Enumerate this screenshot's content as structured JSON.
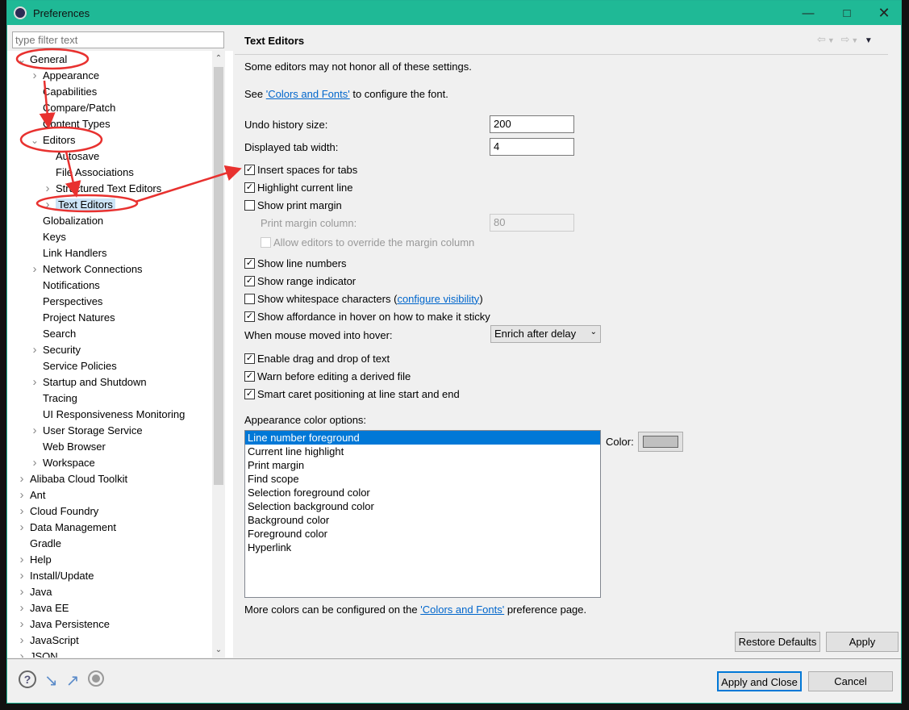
{
  "window": {
    "title": "Preferences",
    "controls": [
      "minimize",
      "maximize",
      "close"
    ]
  },
  "filter": {
    "placeholder": "type filter text",
    "value": ""
  },
  "tree": [
    {
      "label": "General",
      "level": 0,
      "arrow": "expanded"
    },
    {
      "label": "Appearance",
      "level": 1,
      "arrow": "collapsed"
    },
    {
      "label": "Capabilities",
      "level": 1,
      "arrow": ""
    },
    {
      "label": "Compare/Patch",
      "level": 1,
      "arrow": ""
    },
    {
      "label": "Content Types",
      "level": 1,
      "arrow": ""
    },
    {
      "label": "Editors",
      "level": 1,
      "arrow": "expanded"
    },
    {
      "label": "Autosave",
      "level": 2,
      "arrow": ""
    },
    {
      "label": "File Associations",
      "level": 2,
      "arrow": ""
    },
    {
      "label": "Structured Text Editors",
      "level": 2,
      "arrow": "collapsed"
    },
    {
      "label": "Text Editors",
      "level": 2,
      "arrow": "collapsed",
      "selected": true
    },
    {
      "label": "Globalization",
      "level": 1,
      "arrow": ""
    },
    {
      "label": "Keys",
      "level": 1,
      "arrow": ""
    },
    {
      "label": "Link Handlers",
      "level": 1,
      "arrow": ""
    },
    {
      "label": "Network Connections",
      "level": 1,
      "arrow": "collapsed"
    },
    {
      "label": "Notifications",
      "level": 1,
      "arrow": ""
    },
    {
      "label": "Perspectives",
      "level": 1,
      "arrow": ""
    },
    {
      "label": "Project Natures",
      "level": 1,
      "arrow": ""
    },
    {
      "label": "Search",
      "level": 1,
      "arrow": ""
    },
    {
      "label": "Security",
      "level": 1,
      "arrow": "collapsed"
    },
    {
      "label": "Service Policies",
      "level": 1,
      "arrow": ""
    },
    {
      "label": "Startup and Shutdown",
      "level": 1,
      "arrow": "collapsed"
    },
    {
      "label": "Tracing",
      "level": 1,
      "arrow": ""
    },
    {
      "label": "UI Responsiveness Monitoring",
      "level": 1,
      "arrow": ""
    },
    {
      "label": "User Storage Service",
      "level": 1,
      "arrow": "collapsed"
    },
    {
      "label": "Web Browser",
      "level": 1,
      "arrow": ""
    },
    {
      "label": "Workspace",
      "level": 1,
      "arrow": "collapsed"
    },
    {
      "label": "Alibaba Cloud Toolkit",
      "level": 0,
      "arrow": "collapsed"
    },
    {
      "label": "Ant",
      "level": 0,
      "arrow": "collapsed"
    },
    {
      "label": "Cloud Foundry",
      "level": 0,
      "arrow": "collapsed"
    },
    {
      "label": "Data Management",
      "level": 0,
      "arrow": "collapsed"
    },
    {
      "label": "Gradle",
      "level": 0,
      "arrow": ""
    },
    {
      "label": "Help",
      "level": 0,
      "arrow": "collapsed"
    },
    {
      "label": "Install/Update",
      "level": 0,
      "arrow": "collapsed"
    },
    {
      "label": "Java",
      "level": 0,
      "arrow": "collapsed"
    },
    {
      "label": "Java EE",
      "level": 0,
      "arrow": "collapsed"
    },
    {
      "label": "Java Persistence",
      "level": 0,
      "arrow": "collapsed"
    },
    {
      "label": "JavaScript",
      "level": 0,
      "arrow": "collapsed"
    },
    {
      "label": "JSON",
      "level": 0,
      "arrow": "collapsed"
    }
  ],
  "page": {
    "title": "Text Editors",
    "note": "Some editors may not honor all of these settings.",
    "see_prefix": "See ",
    "see_link": "'Colors and Fonts'",
    "see_suffix": " to configure the font.",
    "undo_label": "Undo history size:",
    "undo_value": "200",
    "tab_label": "Displayed tab width:",
    "tab_value": "4",
    "checks1": [
      {
        "label": "Insert spaces for tabs",
        "checked": true
      },
      {
        "label": "Highlight current line",
        "checked": true
      },
      {
        "label": "Show print margin",
        "checked": false
      }
    ],
    "margin_label": "Print margin column:",
    "margin_value": "80",
    "allow_override": {
      "label": "Allow editors to override the margin column",
      "checked": false,
      "disabled": true
    },
    "checks2": [
      {
        "label": "Show line numbers",
        "checked": true
      },
      {
        "label": "Show range indicator",
        "checked": true
      },
      {
        "label": "Show whitespace characters",
        "checked": false
      },
      {
        "label": "Show affordance in hover on how to make it sticky",
        "checked": true
      }
    ],
    "whitespace_link": "configure visibility",
    "hover_label": "When mouse moved into hover:",
    "hover_value": "Enrich after delay",
    "checks3": [
      {
        "label": "Enable drag and drop of text",
        "checked": true
      },
      {
        "label": "Warn before editing a derived file",
        "checked": true
      },
      {
        "label": "Smart caret positioning at line start and end",
        "checked": true
      }
    ],
    "color_options_label": "Appearance color options:",
    "color_options": [
      "Line number foreground",
      "Current line highlight",
      "Print margin",
      "Find scope",
      "Selection foreground color",
      "Selection background color",
      "Background color",
      "Foreground color",
      "Hyperlink"
    ],
    "color_label": "Color:",
    "color_value": "#c0c0c0",
    "more_prefix": "More colors can be configured on the ",
    "more_link": "'Colors and Fonts'",
    "more_suffix": " preference page.",
    "restore_defaults": "Restore Defaults",
    "apply": "Apply"
  },
  "footer": {
    "apply_close": "Apply and Close",
    "cancel": "Cancel",
    "icons": [
      "help-icon",
      "import-icon",
      "export-icon",
      "record-icon"
    ]
  },
  "colors": {
    "titlebar": "#1fb996",
    "selection": "#0078d7",
    "annotation": "#e8312f"
  }
}
